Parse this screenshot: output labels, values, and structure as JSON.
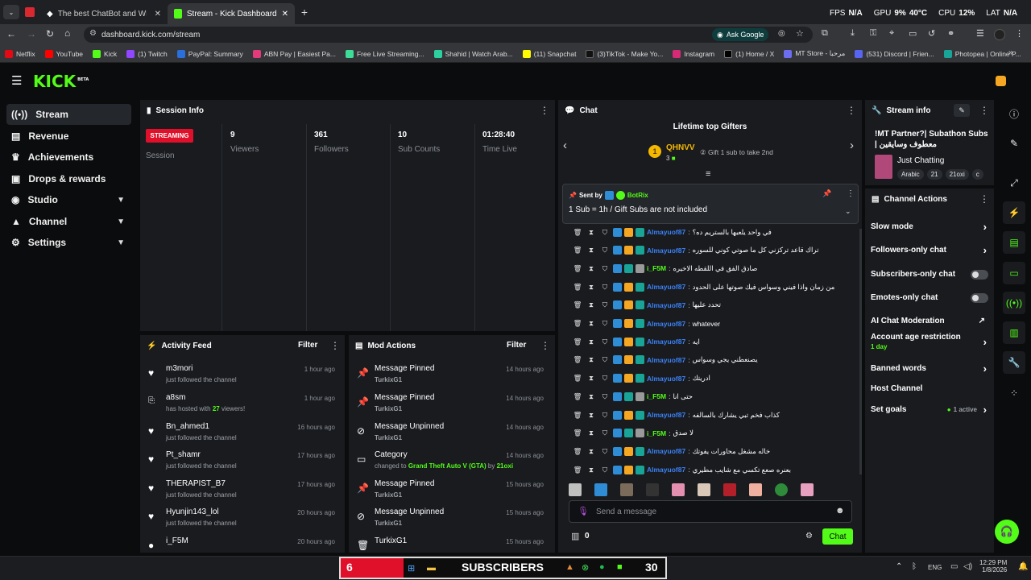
{
  "browser": {
    "tabs": [
      {
        "label": "The best ChatBot and Widgets"
      },
      {
        "label": "Stream - Kick Dashboard"
      }
    ],
    "url": "dashboard.kick.com/stream",
    "ask_google": "Ask Google",
    "overlay": {
      "fps_label": "FPS",
      "fps_value": "N/A",
      "gpu_label": "GPU",
      "gpu_value": "9%",
      "gpu_temp": "40°C",
      "cpu_label": "CPU",
      "cpu_value": "12%",
      "lat_label": "LAT",
      "lat_value": "N/A"
    },
    "bookmarks": [
      "Netflix",
      "YouTube",
      "Kick",
      "(1) Twitch",
      "PayPal: Summary",
      "ABN Pay | Easiest Pa...",
      "Free Live Streaming...",
      "Shahid | Watch Arab...",
      "(11) Snapchat",
      "(3)TikTok - Make Yo...",
      "Instagram",
      "(1) Home / X",
      "MT Store - مرحبا",
      "(531) Discord | Frien...",
      "Photopea | Online P..."
    ]
  },
  "header": {
    "logo": "KICK",
    "logo_badge": "BETA"
  },
  "sidebar": {
    "items": [
      {
        "label": "Stream",
        "icon": "stream-icon"
      },
      {
        "label": "Revenue",
        "icon": "revenue-icon"
      },
      {
        "label": "Achievements",
        "icon": "trophy-icon"
      },
      {
        "label": "Drops & rewards",
        "icon": "gift-icon"
      },
      {
        "label": "Studio",
        "icon": "studio-icon"
      },
      {
        "label": "Channel",
        "icon": "channel-icon"
      },
      {
        "label": "Settings",
        "icon": "gear-icon"
      }
    ]
  },
  "session": {
    "title": "Session Info",
    "status": "STREAMING",
    "session_label": "Session",
    "stats": [
      {
        "value": "9",
        "label": "Viewers"
      },
      {
        "value": "361",
        "label": "Followers"
      },
      {
        "value": "10",
        "label": "Sub Counts"
      },
      {
        "value": "01:28:40",
        "label": "Time Live"
      }
    ]
  },
  "activity": {
    "title": "Activity Feed",
    "filter": "Filter",
    "rows": [
      {
        "name": "m3mori",
        "text": "just followed the channel",
        "time": "1 hour ago"
      },
      {
        "name": "a8sm",
        "text": "has hosted with 27 viewers!",
        "time": "1 hour ago"
      },
      {
        "name": "Bn_ahmed1",
        "text": "just followed the channel",
        "time": "16 hours ago"
      },
      {
        "name": "Pt_shamr",
        "text": "just followed the channel",
        "time": "17 hours ago"
      },
      {
        "name": "THERAPIST_B7",
        "text": "just followed the channel",
        "time": "17 hours ago"
      },
      {
        "name": "Hyunjin143_lol",
        "text": "just followed the channel",
        "time": "20 hours ago"
      },
      {
        "name": "i_F5M",
        "text": "",
        "time": "20 hours ago"
      }
    ]
  },
  "mod": {
    "title": "Mod Actions",
    "filter": "Filter",
    "rows": [
      {
        "action": "Message Pinned",
        "by": "TurkixG1",
        "time": "14 hours ago",
        "icon": "pin-icon"
      },
      {
        "action": "Message Pinned",
        "by": "TurkixG1",
        "time": "14 hours ago",
        "icon": "pin-icon"
      },
      {
        "action": "Message Unpinned",
        "by": "TurkixG1",
        "time": "14 hours ago",
        "icon": "unpin-icon"
      },
      {
        "action": "Category",
        "by": "changed to Grand Theft Auto V (GTA) by 21oxi",
        "time": "14 hours ago",
        "icon": "category-icon"
      },
      {
        "action": "Message Pinned",
        "by": "TurkixG1",
        "time": "15 hours ago",
        "icon": "pin-icon"
      },
      {
        "action": "Message Unpinned",
        "by": "TurkixG1",
        "time": "15 hours ago",
        "icon": "unpin-icon"
      },
      {
        "action": "TurkixG1",
        "by": "",
        "time": "15 hours ago",
        "icon": "trash-icon"
      }
    ]
  },
  "chat": {
    "title": "Chat",
    "gifters_title": "Lifetime top Gifters",
    "top_gifter": "QHNVV",
    "top_gifter_count": "3",
    "gift_hint": "Gift 1 sub to take 2nd",
    "pinned_sent_by": "Sent by",
    "pinned_user": "BotRix",
    "pinned_text": "1 Sub = 1h / Gift Subs are not included",
    "messages": [
      {
        "user": "Almayuof87",
        "text": "في واحد يلعبها بالستريم ده؟",
        "green": false
      },
      {
        "user": "Almayuof87",
        "text": "تراك قاعد تركزني كل ما صوتي كوني للسوره",
        "green": false
      },
      {
        "user": "i_F5M",
        "text": "صادق الفق في اللقطه الاخيره",
        "green": true
      },
      {
        "user": "Almayuof87",
        "text": "من زمان واذا فيني وسواس فيك صوتها على الحدود",
        "green": false
      },
      {
        "user": "Almayuof87",
        "text": "تحدد عليها",
        "green": false
      },
      {
        "user": "Almayuof87",
        "text": "whatever",
        "green": false
      },
      {
        "user": "Almayuof87",
        "text": "ايه",
        "green": false
      },
      {
        "user": "Almayuof87",
        "text": "يصنعطني يجي وسواس",
        "green": false
      },
      {
        "user": "Almayuof87",
        "text": "ادريتك",
        "green": false
      },
      {
        "user": "i_F5M",
        "text": "حتى انا",
        "green": true
      },
      {
        "user": "Almayuof87",
        "text": "كذاب فخم تبي يشارك بالسالفه",
        "green": false
      },
      {
        "user": "i_F5M",
        "text": "لا صدق",
        "green": true
      },
      {
        "user": "Almayuof87",
        "text": "خاله مشغل محاورات يفوتك",
        "green": false
      },
      {
        "user": "Almayuof87",
        "text": "بعنره صعع تكسي مع شايب مطيري",
        "green": false
      }
    ],
    "input_placeholder": "Send a message",
    "points": "0",
    "send_label": "Chat"
  },
  "stream_info": {
    "title": "Stream info",
    "stream_title": "!MT Partner?| Subathon Subs | معطوف وسايقين",
    "category": "Just Chatting",
    "tags": [
      "Arabic",
      "21",
      "21oxi",
      "c"
    ]
  },
  "channel_actions": {
    "title": "Channel Actions",
    "items": [
      {
        "label": "Slow mode",
        "control": "chevron"
      },
      {
        "label": "Followers-only chat",
        "control": "chevron"
      },
      {
        "label": "Subscribers-only chat",
        "control": "toggle"
      },
      {
        "label": "Emotes-only chat",
        "control": "toggle"
      },
      {
        "label": "AI Chat Moderation",
        "control": "external"
      },
      {
        "label": "Account age restriction",
        "sub": "1 day",
        "control": "chevron"
      },
      {
        "label": "Banned words",
        "control": "chevron"
      },
      {
        "label": "Host Channel",
        "control": "none"
      },
      {
        "label": "Set goals",
        "sub": "1 active",
        "control": "chevron"
      }
    ]
  },
  "taskbar": {
    "sub_count": "6",
    "banner": "SUBSCRIBERS",
    "goal": "30",
    "lang": "ENG",
    "time": "12:29 PM",
    "date": "1/8/2026"
  },
  "colors": {
    "accent": "#53fc18",
    "streaming": "#e0102a",
    "panel": "#191b1f",
    "link": "#3b82f6"
  }
}
